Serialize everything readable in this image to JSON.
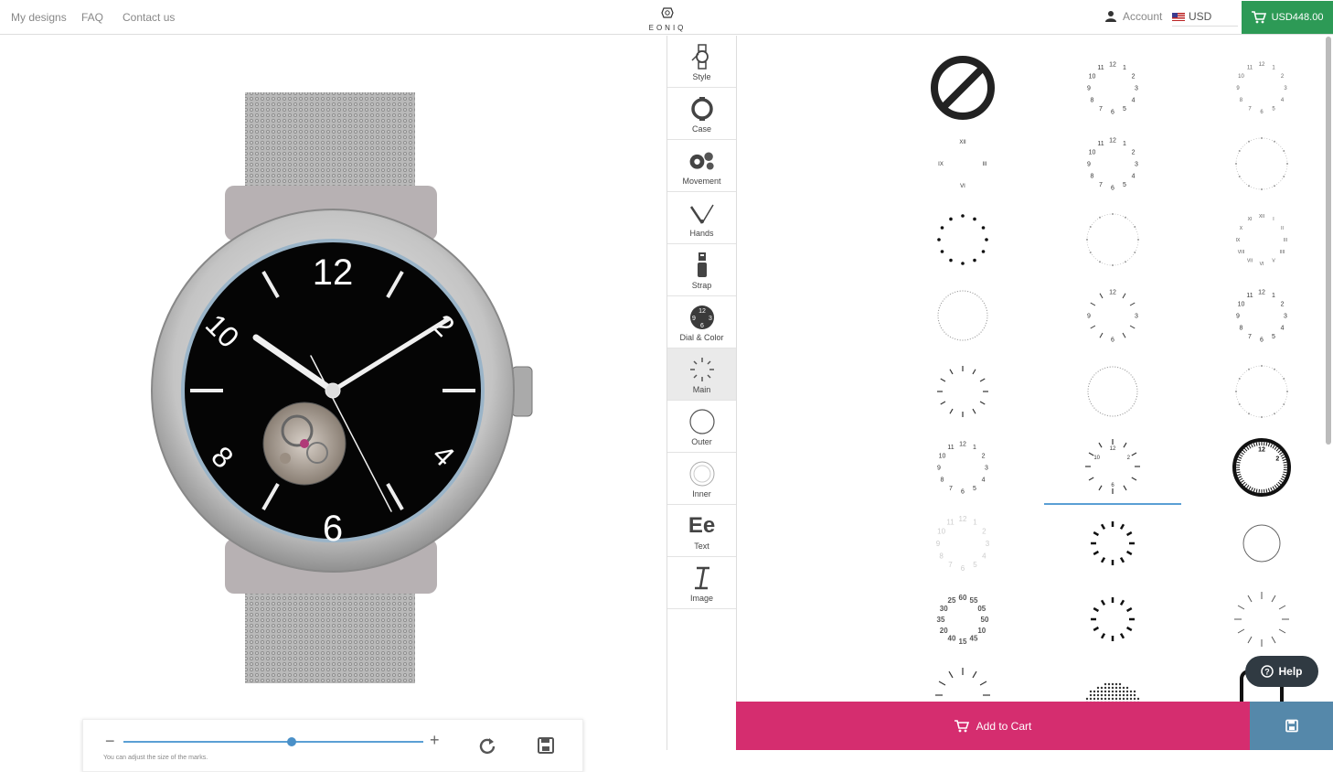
{
  "nav": {
    "my_designs": "My designs",
    "faq": "FAQ",
    "contact": "Contact us"
  },
  "brand": {
    "logo_text": "EONIQ"
  },
  "account": {
    "label": "Account"
  },
  "currency": {
    "selected": "USD"
  },
  "cart": {
    "price": "USD448.00"
  },
  "watch_dial": {
    "n12": "12",
    "n6": "6",
    "n10": "10",
    "n2": "2",
    "n8": "8",
    "n4": "4"
  },
  "sizer": {
    "hint": "You can adjust the size of the marks.",
    "minus": "−",
    "plus": "+",
    "value_fraction": 0.56
  },
  "tools": [
    {
      "label": "Style",
      "icon": "style-icon"
    },
    {
      "label": "Case",
      "icon": "case-icon"
    },
    {
      "label": "Movement",
      "icon": "movement-icon"
    },
    {
      "label": "Hands",
      "icon": "hands-icon"
    },
    {
      "label": "Strap",
      "icon": "strap-icon"
    },
    {
      "label": "Dial & Color",
      "icon": "dial-color-icon"
    },
    {
      "label": "Main",
      "icon": "main-marks-icon"
    },
    {
      "label": "Outer",
      "icon": "outer-marks-icon"
    },
    {
      "label": "Inner",
      "icon": "inner-marks-icon"
    },
    {
      "label": "Text",
      "icon": "text-icon"
    },
    {
      "label": "Image",
      "icon": "image-icon"
    }
  ],
  "tools_text_glyph": "Ee",
  "dial_options": [
    {
      "style": "none"
    },
    {
      "style": "arabic-full"
    },
    {
      "style": "arabic-thin"
    },
    {
      "style": "arabic-bold"
    },
    {
      "style": "roman-sparse"
    },
    {
      "style": "arabic-full"
    },
    {
      "style": "dots-faint"
    },
    {
      "style": "roman-full"
    },
    {
      "style": "dots-bold"
    },
    {
      "style": "dots-faint"
    },
    {
      "style": "roman-small"
    },
    {
      "style": "bars-sparse"
    },
    {
      "style": "minute-ring"
    },
    {
      "style": "arabic-quarters"
    },
    {
      "style": "arabic-full"
    },
    {
      "style": "roman-full"
    },
    {
      "style": "bars-12"
    },
    {
      "style": "minute-ring"
    },
    {
      "style": "dots-faint"
    },
    {
      "style": "dots-faint"
    },
    {
      "style": "arabic-full"
    },
    {
      "style": "bars-arabic"
    },
    {
      "style": "thick-ring"
    },
    {
      "style": "triangles"
    },
    {
      "style": "arabic-faint"
    },
    {
      "style": "bold-bars-small"
    },
    {
      "style": "plain-circle"
    },
    {
      "style": "bars-sparse"
    },
    {
      "style": "minutes-numbers"
    },
    {
      "style": "bold-bars-small"
    },
    {
      "style": "bars-sparse"
    },
    {
      "style": "bars-long"
    },
    {
      "style": "bars-partial"
    },
    {
      "style": "dot-pattern"
    },
    {
      "style": "square-partial"
    },
    {
      "style": "square-partial"
    }
  ],
  "dial_minutes_labels": [
    "60",
    "55",
    "05",
    "50",
    "10",
    "45",
    "15",
    "40",
    "20",
    "35",
    "30",
    "25"
  ],
  "selected_option_index": 21,
  "add_to_cart": {
    "label": "Add to Cart"
  },
  "help": {
    "label": "Help"
  },
  "colors": {
    "accent": "#d52d6f",
    "cart_green": "#2d9a56",
    "save_blue": "#5588aa",
    "slider_blue": "#5a9fd4"
  }
}
